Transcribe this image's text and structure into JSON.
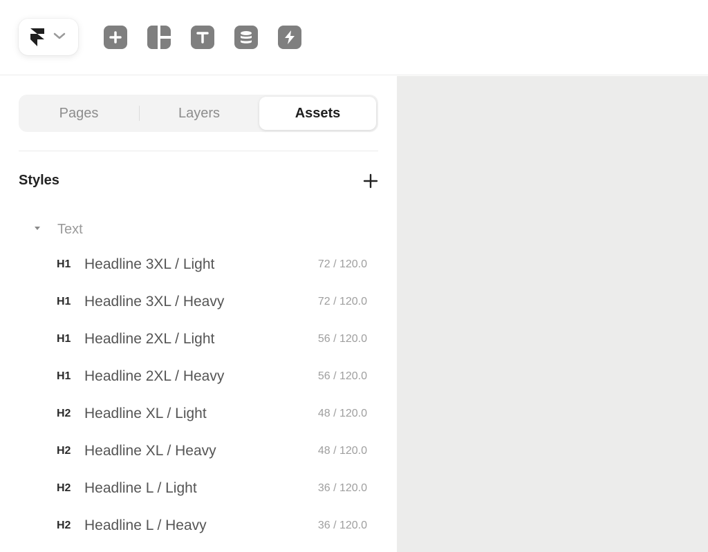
{
  "toolbar": {
    "menu_icons": [
      "framer-logo-icon",
      "chevron-down-icon"
    ],
    "tools": [
      {
        "name": "insert",
        "icon": "plus-square-icon"
      },
      {
        "name": "layout",
        "icon": "layout-icon"
      },
      {
        "name": "text",
        "icon": "text-icon"
      },
      {
        "name": "cms",
        "icon": "database-icon"
      },
      {
        "name": "interactions",
        "icon": "lightning-icon"
      }
    ]
  },
  "panel_tabs": {
    "pages": "Pages",
    "layers": "Layers",
    "assets": "Assets",
    "active": "Assets"
  },
  "styles": {
    "title": "Styles",
    "add_icon": "plus-icon",
    "group": {
      "label": "Text",
      "expanded": true,
      "items": [
        {
          "tag": "H1",
          "name": "Headline 3XL / Light",
          "meta": "72 / 120.0"
        },
        {
          "tag": "H1",
          "name": "Headline 3XL / Heavy",
          "meta": "72 / 120.0"
        },
        {
          "tag": "H1",
          "name": "Headline 2XL / Light",
          "meta": "56 / 120.0"
        },
        {
          "tag": "H1",
          "name": "Headline 2XL / Heavy",
          "meta": "56 / 120.0"
        },
        {
          "tag": "H2",
          "name": "Headline XL / Light",
          "meta": "48 / 120.0"
        },
        {
          "tag": "H2",
          "name": "Headline XL / Heavy",
          "meta": "48 / 120.0"
        },
        {
          "tag": "H2",
          "name": "Headline L / Light",
          "meta": "36 / 120.0"
        },
        {
          "tag": "H2",
          "name": "Headline L / Heavy",
          "meta": "36 / 120.0"
        }
      ]
    }
  },
  "colors": {
    "canvas": "#ececeb",
    "tool_icon": "#7f7f7f",
    "active_tab_bg": "#ffffff"
  }
}
